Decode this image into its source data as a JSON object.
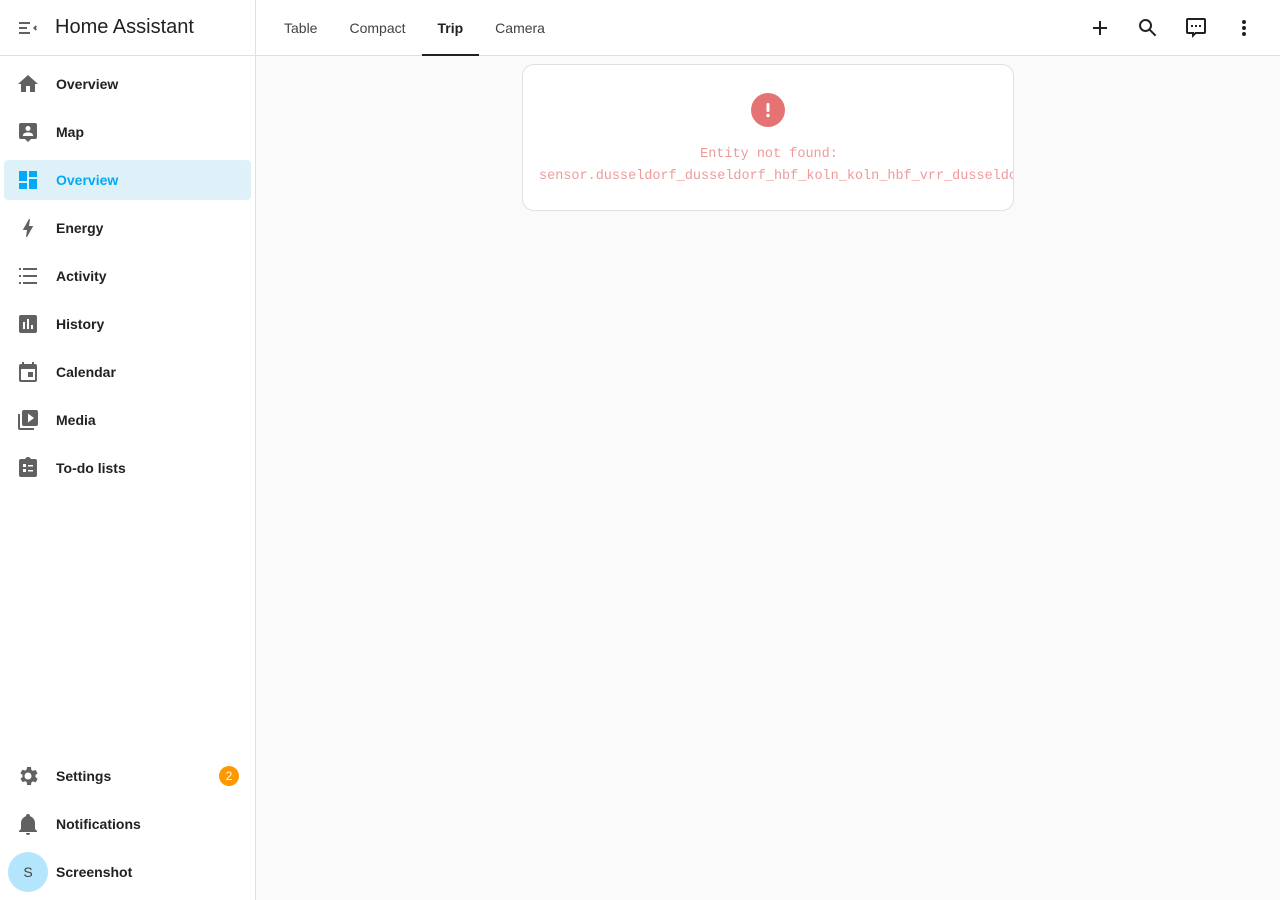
{
  "sidebar": {
    "title": "Home Assistant",
    "items": [
      {
        "label": "Overview",
        "icon": "home-icon"
      },
      {
        "label": "Map",
        "icon": "map-person-icon"
      },
      {
        "label": "Overview",
        "icon": "dashboard-icon",
        "active": true
      },
      {
        "label": "Energy",
        "icon": "lightning-bolt-icon"
      },
      {
        "label": "Activity",
        "icon": "format-list-bulleted-icon"
      },
      {
        "label": "History",
        "icon": "chart-box-icon"
      },
      {
        "label": "Calendar",
        "icon": "calendar-icon"
      },
      {
        "label": "Media",
        "icon": "play-box-multiple-icon"
      },
      {
        "label": "To-do lists",
        "icon": "clipboard-list-icon"
      }
    ],
    "bottom": {
      "settings": {
        "label": "Settings",
        "badge": "2"
      },
      "notifications": {
        "label": "Notifications"
      },
      "user": {
        "label": "Screenshot",
        "initial": "S"
      }
    }
  },
  "topbar": {
    "tabs": [
      "Table",
      "Compact",
      "Trip",
      "Camera"
    ],
    "active_tab": "Trip",
    "actions": [
      "plus-icon",
      "search-icon",
      "assist-chat-icon",
      "more-vertical-icon"
    ]
  },
  "card": {
    "error_title": "Entity not found:",
    "entity": "sensor.dusseldorf_dusseldorf_hbf_koln_koln_hbf_vrr_dusseldorf"
  },
  "colors": {
    "accent": "#03a9f4",
    "active_bg": "#dff1f8",
    "error": "#e57373",
    "badge": "#ff9800"
  }
}
